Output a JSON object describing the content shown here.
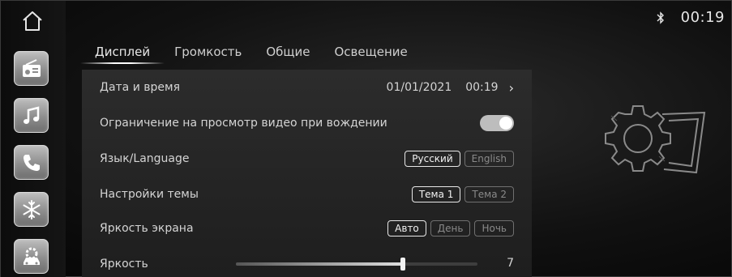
{
  "status": {
    "time": "00:19"
  },
  "rail": {
    "apps": [
      "radio-icon",
      "music-icon",
      "phone-icon",
      "climate-icon",
      "car-settings-icon"
    ]
  },
  "tabs": [
    {
      "label": "Дисплей",
      "active": true
    },
    {
      "label": "Громкость",
      "active": false
    },
    {
      "label": "Общие",
      "active": false
    },
    {
      "label": "Освещение",
      "active": false
    }
  ],
  "settings": {
    "datetime": {
      "label": "Дата и время",
      "date": "01/01/2021",
      "time": "00:19"
    },
    "video_limit": {
      "label": "Ограничение на просмотр видео при вождении",
      "enabled": true
    },
    "language": {
      "label": "Язык/Language",
      "options": [
        "Русский",
        "English"
      ],
      "selected": "Русский"
    },
    "theme": {
      "label": "Настройки темы",
      "options": [
        "Тема 1",
        "Тема 2"
      ],
      "selected": "Тема 1"
    },
    "screen_brightness": {
      "label": "Яркость экрана",
      "options": [
        "Авто",
        "День",
        "Ночь"
      ],
      "selected": "Авто"
    },
    "brightness": {
      "label": "Яркость",
      "value": "7",
      "fraction": 0.69
    }
  }
}
